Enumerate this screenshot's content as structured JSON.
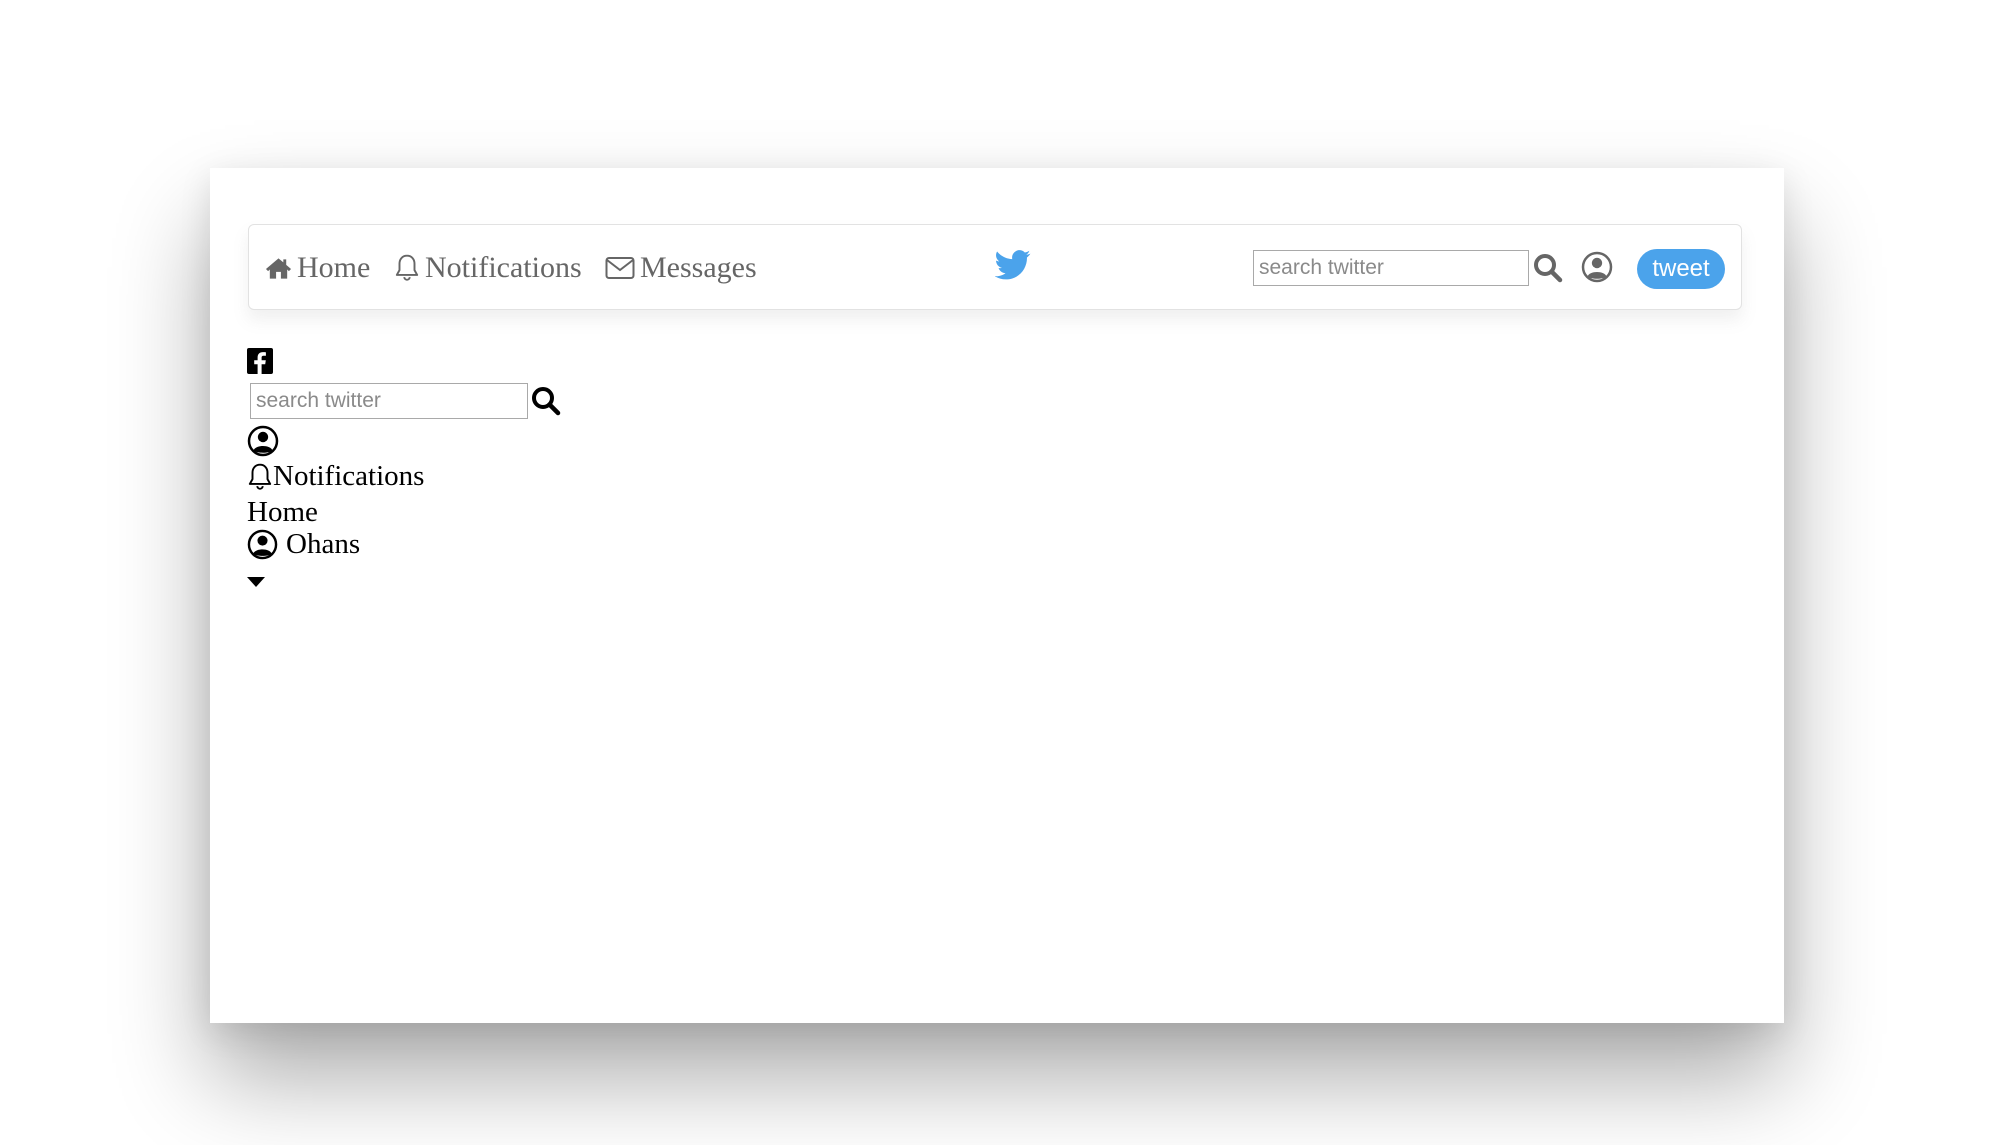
{
  "navbar": {
    "home_label": "Home",
    "notifications_label": "Notifications",
    "messages_label": "Messages",
    "logo_icon": "twitter-bird-icon",
    "search_placeholder": "search twitter",
    "tweet_label": "tweet"
  },
  "dropdown": {
    "icons": [
      "facebook-icon",
      "search-icon",
      "user-circle-icon",
      "bell-icon",
      "caret-down-icon"
    ],
    "search_placeholder": "search twitter",
    "notifications_label": "Notifications",
    "home_label": "Home",
    "user_name": "Ohans"
  },
  "colors": {
    "accent": "#4ba3eb",
    "nav_text": "#666666",
    "border": "#e2e2e2"
  }
}
